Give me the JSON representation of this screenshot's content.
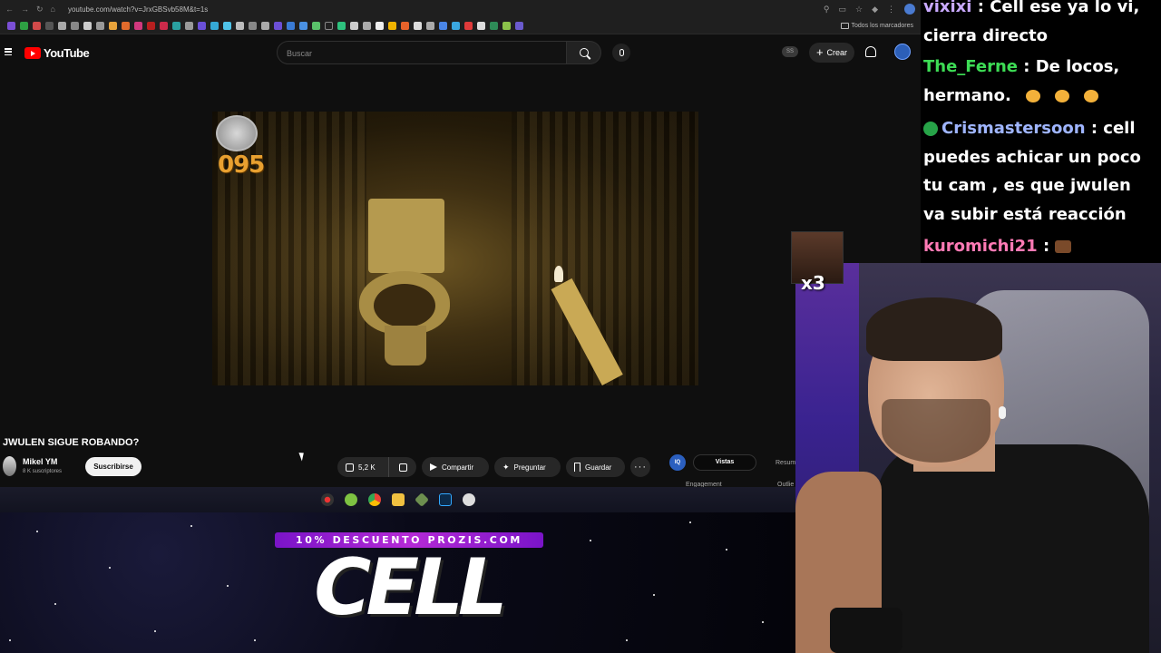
{
  "browser": {
    "url": "youtube.com/watch?v=JrxGBSvb58M&t=1s",
    "bookmarks_folder_label": "Todos los marcadores"
  },
  "youtube": {
    "logo_text": "YouTube",
    "search_placeholder": "Buscar",
    "badge": "SS",
    "create_label": "Crear"
  },
  "video": {
    "coin_counter": "095"
  },
  "video_info": {
    "title": "JWULEN SIGUE ROBANDO?",
    "channel_name": "Mikel YM",
    "subscribers": "8 K suscriptores",
    "subscribe_label": "Suscribirse",
    "likes": "5,2 K",
    "share_label": "Compartir",
    "ask_label": "Preguntar",
    "save_label": "Guardar"
  },
  "extension": {
    "icon_text": "IQ",
    "tab_views": "Vistas",
    "tab_summary": "Resum",
    "label_engagement": "Engagement",
    "label_outlier": "Outlie"
  },
  "stream": {
    "promo_text": "10% DESCUENTO PROZIS.COM",
    "logo_text": "CELL",
    "emote_multiplier": "x3"
  },
  "chat": {
    "messages": [
      {
        "user": "vixixi",
        "color": "#c9a9ff",
        "sep": " : ",
        "text": "Cell ese ya lo vi, cierra directo"
      },
      {
        "user": "The_Ferne",
        "color": "#3ddc55",
        "sep": " : ",
        "text": "De locos, hermano."
      },
      {
        "user": "Crismastersoon",
        "color": "#9fb5ff",
        "sep": " : ",
        "text": "cell puedes achicar un poco tu cam , es que jwulen va subir está reacción"
      },
      {
        "user": "kuromichi21",
        "color": "#ff7ab5",
        "sep": " : ",
        "text": ""
      }
    ]
  },
  "colors": {
    "youtube_red": "#ff0000",
    "promo_purple": "#9a1fd0",
    "page_bg": "#0f0f0f"
  },
  "icons": [
    "menu-icon",
    "search-icon",
    "mic-icon",
    "plus-icon",
    "bell-icon",
    "like-icon",
    "dislike-icon",
    "share-icon",
    "sparkle-icon",
    "bookmark-icon",
    "more-icon"
  ]
}
